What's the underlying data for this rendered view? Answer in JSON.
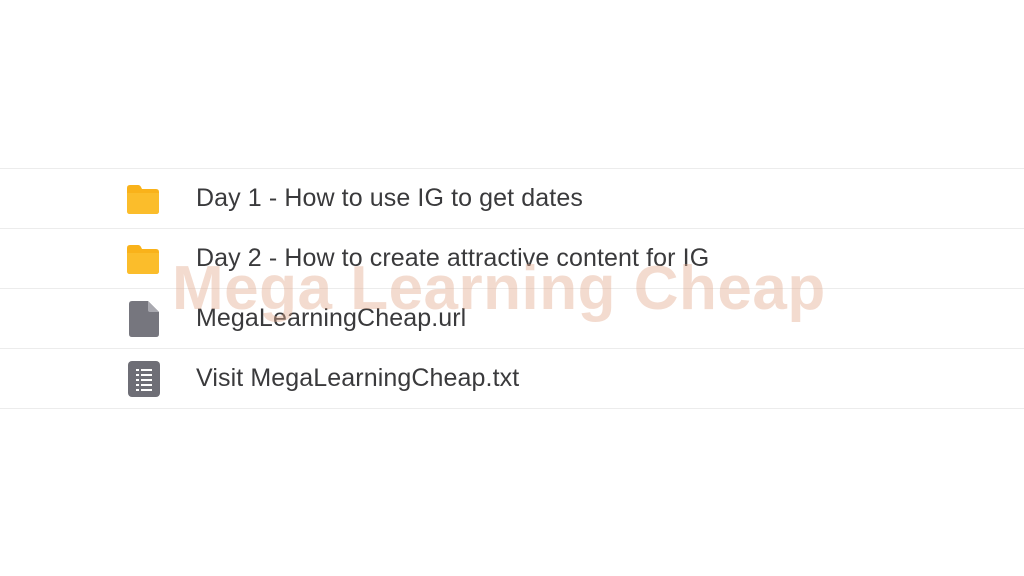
{
  "files": [
    {
      "type": "folder",
      "icon": "folder-icon",
      "name": "Day 1 - How to use IG to get dates"
    },
    {
      "type": "folder",
      "icon": "folder-icon",
      "name": "Day 2 - How to create attractive content for IG"
    },
    {
      "type": "file",
      "icon": "document-icon",
      "name": "MegaLearningCheap.url"
    },
    {
      "type": "text",
      "icon": "text-file-icon",
      "name": "Visit MegaLearningCheap.txt"
    }
  ],
  "watermark": "Mega Learning Cheap",
  "colors": {
    "folder": "#f9b21a",
    "file": "#76767e",
    "text": "#3a3a3c",
    "divider": "#ececec",
    "watermark": "#e2aa8c"
  }
}
